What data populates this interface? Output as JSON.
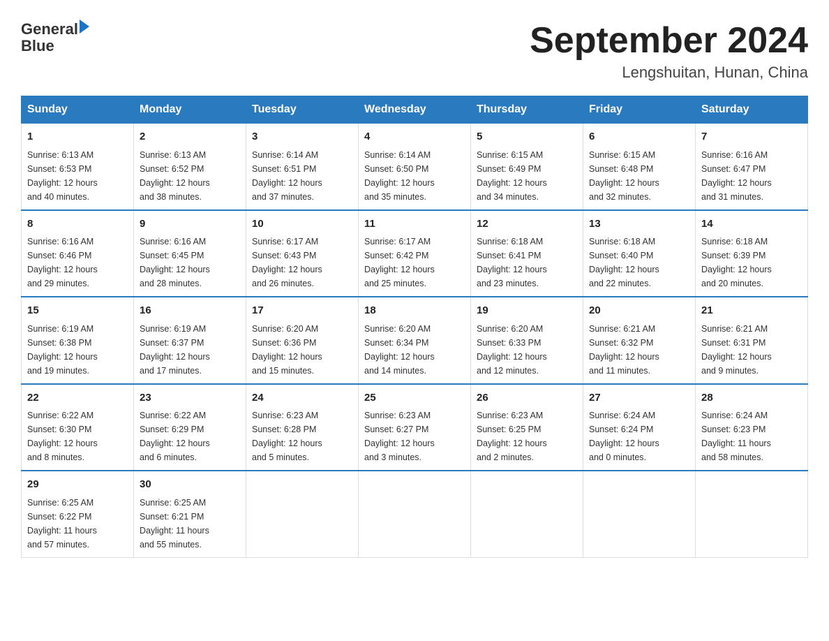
{
  "header": {
    "logo_text_general": "General",
    "logo_text_blue": "Blue",
    "title": "September 2024",
    "subtitle": "Lengshuitan, Hunan, China"
  },
  "weekdays": [
    "Sunday",
    "Monday",
    "Tuesday",
    "Wednesday",
    "Thursday",
    "Friday",
    "Saturday"
  ],
  "weeks": [
    [
      {
        "day": "1",
        "sunrise": "6:13 AM",
        "sunset": "6:53 PM",
        "daylight": "12 hours and 40 minutes."
      },
      {
        "day": "2",
        "sunrise": "6:13 AM",
        "sunset": "6:52 PM",
        "daylight": "12 hours and 38 minutes."
      },
      {
        "day": "3",
        "sunrise": "6:14 AM",
        "sunset": "6:51 PM",
        "daylight": "12 hours and 37 minutes."
      },
      {
        "day": "4",
        "sunrise": "6:14 AM",
        "sunset": "6:50 PM",
        "daylight": "12 hours and 35 minutes."
      },
      {
        "day": "5",
        "sunrise": "6:15 AM",
        "sunset": "6:49 PM",
        "daylight": "12 hours and 34 minutes."
      },
      {
        "day": "6",
        "sunrise": "6:15 AM",
        "sunset": "6:48 PM",
        "daylight": "12 hours and 32 minutes."
      },
      {
        "day": "7",
        "sunrise": "6:16 AM",
        "sunset": "6:47 PM",
        "daylight": "12 hours and 31 minutes."
      }
    ],
    [
      {
        "day": "8",
        "sunrise": "6:16 AM",
        "sunset": "6:46 PM",
        "daylight": "12 hours and 29 minutes."
      },
      {
        "day": "9",
        "sunrise": "6:16 AM",
        "sunset": "6:45 PM",
        "daylight": "12 hours and 28 minutes."
      },
      {
        "day": "10",
        "sunrise": "6:17 AM",
        "sunset": "6:43 PM",
        "daylight": "12 hours and 26 minutes."
      },
      {
        "day": "11",
        "sunrise": "6:17 AM",
        "sunset": "6:42 PM",
        "daylight": "12 hours and 25 minutes."
      },
      {
        "day": "12",
        "sunrise": "6:18 AM",
        "sunset": "6:41 PM",
        "daylight": "12 hours and 23 minutes."
      },
      {
        "day": "13",
        "sunrise": "6:18 AM",
        "sunset": "6:40 PM",
        "daylight": "12 hours and 22 minutes."
      },
      {
        "day": "14",
        "sunrise": "6:18 AM",
        "sunset": "6:39 PM",
        "daylight": "12 hours and 20 minutes."
      }
    ],
    [
      {
        "day": "15",
        "sunrise": "6:19 AM",
        "sunset": "6:38 PM",
        "daylight": "12 hours and 19 minutes."
      },
      {
        "day": "16",
        "sunrise": "6:19 AM",
        "sunset": "6:37 PM",
        "daylight": "12 hours and 17 minutes."
      },
      {
        "day": "17",
        "sunrise": "6:20 AM",
        "sunset": "6:36 PM",
        "daylight": "12 hours and 15 minutes."
      },
      {
        "day": "18",
        "sunrise": "6:20 AM",
        "sunset": "6:34 PM",
        "daylight": "12 hours and 14 minutes."
      },
      {
        "day": "19",
        "sunrise": "6:20 AM",
        "sunset": "6:33 PM",
        "daylight": "12 hours and 12 minutes."
      },
      {
        "day": "20",
        "sunrise": "6:21 AM",
        "sunset": "6:32 PM",
        "daylight": "12 hours and 11 minutes."
      },
      {
        "day": "21",
        "sunrise": "6:21 AM",
        "sunset": "6:31 PM",
        "daylight": "12 hours and 9 minutes."
      }
    ],
    [
      {
        "day": "22",
        "sunrise": "6:22 AM",
        "sunset": "6:30 PM",
        "daylight": "12 hours and 8 minutes."
      },
      {
        "day": "23",
        "sunrise": "6:22 AM",
        "sunset": "6:29 PM",
        "daylight": "12 hours and 6 minutes."
      },
      {
        "day": "24",
        "sunrise": "6:23 AM",
        "sunset": "6:28 PM",
        "daylight": "12 hours and 5 minutes."
      },
      {
        "day": "25",
        "sunrise": "6:23 AM",
        "sunset": "6:27 PM",
        "daylight": "12 hours and 3 minutes."
      },
      {
        "day": "26",
        "sunrise": "6:23 AM",
        "sunset": "6:25 PM",
        "daylight": "12 hours and 2 minutes."
      },
      {
        "day": "27",
        "sunrise": "6:24 AM",
        "sunset": "6:24 PM",
        "daylight": "12 hours and 0 minutes."
      },
      {
        "day": "28",
        "sunrise": "6:24 AM",
        "sunset": "6:23 PM",
        "daylight": "11 hours and 58 minutes."
      }
    ],
    [
      {
        "day": "29",
        "sunrise": "6:25 AM",
        "sunset": "6:22 PM",
        "daylight": "11 hours and 57 minutes."
      },
      {
        "day": "30",
        "sunrise": "6:25 AM",
        "sunset": "6:21 PM",
        "daylight": "11 hours and 55 minutes."
      },
      null,
      null,
      null,
      null,
      null
    ]
  ],
  "labels": {
    "sunrise": "Sunrise:",
    "sunset": "Sunset:",
    "daylight": "Daylight:"
  }
}
